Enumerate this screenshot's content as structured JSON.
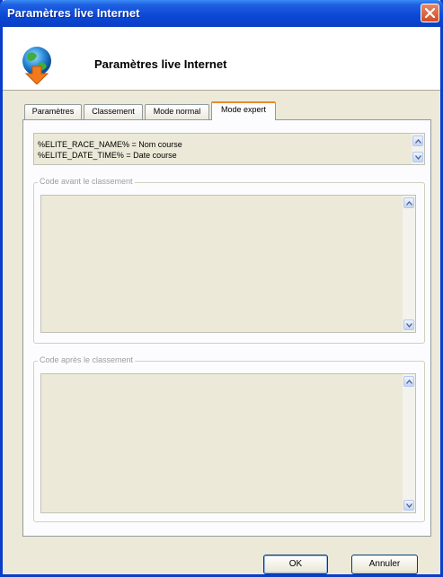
{
  "window": {
    "title": "Paramètres live Internet"
  },
  "header": {
    "title": "Paramètres live Internet",
    "icon": "globe-upload-icon"
  },
  "tabs": [
    {
      "label": "Paramètres",
      "active": false
    },
    {
      "label": "Classement",
      "active": false
    },
    {
      "label": "Mode normal",
      "active": false
    },
    {
      "label": "Mode expert",
      "active": true
    }
  ],
  "variables": {
    "lines": [
      "%ELITE_RACE_NAME% = Nom course",
      "%ELITE_DATE_TIME% = Date course"
    ]
  },
  "code_before": {
    "legend": "Code avant le classement",
    "value": ""
  },
  "code_after": {
    "legend": "Code après le classement",
    "value": ""
  },
  "buttons": {
    "ok": "OK",
    "cancel": "Annuler"
  },
  "colors": {
    "titlebar": "#0b48d6",
    "active_tab_accent": "#e68b2c",
    "close_button": "#d24a22"
  }
}
